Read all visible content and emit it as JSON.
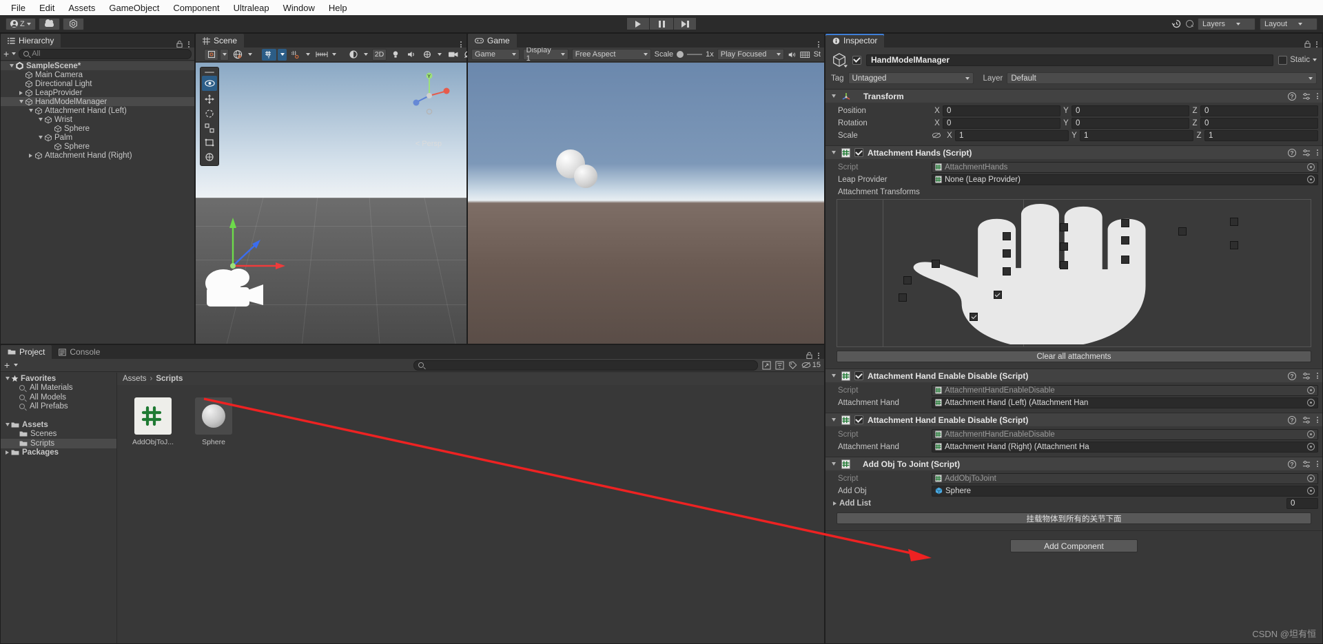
{
  "menubar": {
    "items": [
      "File",
      "Edit",
      "Assets",
      "GameObject",
      "Component",
      "Ultraleap",
      "Window",
      "Help"
    ]
  },
  "toolbar": {
    "account_label": "Z",
    "cloud_icon": "cloud-icon",
    "services_icon": "services-icon",
    "play_icon": "play-icon",
    "pause_icon": "pause-icon",
    "step_icon": "step-icon",
    "history_icon": "history-icon",
    "search_icon": "search-icon",
    "layers_label": "Layers",
    "layout_label": "Layout"
  },
  "hierarchy": {
    "tab": "Hierarchy",
    "search_placeholder": "All",
    "nodes": [
      {
        "label": "SampleScene*",
        "depth": 0,
        "arrow": "down",
        "icon": "unity-icon",
        "selected": false,
        "scene": true
      },
      {
        "label": "Main Camera",
        "depth": 1,
        "arrow": "none",
        "icon": "cube-icon",
        "selected": false
      },
      {
        "label": "Directional Light",
        "depth": 1,
        "arrow": "none",
        "icon": "cube-icon",
        "selected": false
      },
      {
        "label": "LeapProvider",
        "depth": 1,
        "arrow": "right",
        "icon": "cube-icon",
        "selected": false
      },
      {
        "label": "HandModelManager",
        "depth": 1,
        "arrow": "down",
        "icon": "cube-icon",
        "selected": true
      },
      {
        "label": "Attachment Hand (Left)",
        "depth": 2,
        "arrow": "down",
        "icon": "cube-icon",
        "selected": false
      },
      {
        "label": "Wrist",
        "depth": 3,
        "arrow": "down",
        "icon": "cube-icon",
        "selected": false
      },
      {
        "label": "Sphere",
        "depth": 4,
        "arrow": "none",
        "icon": "cube-icon",
        "selected": false
      },
      {
        "label": "Palm",
        "depth": 3,
        "arrow": "down",
        "icon": "cube-icon",
        "selected": false
      },
      {
        "label": "Sphere",
        "depth": 4,
        "arrow": "none",
        "icon": "cube-icon",
        "selected": false
      },
      {
        "label": "Attachment Hand (Right)",
        "depth": 2,
        "arrow": "right",
        "icon": "cube-icon",
        "selected": false
      }
    ]
  },
  "scene": {
    "tab": "Scene",
    "persp_label": "< Persp",
    "toolbar": {
      "draw_mode": "shaded-dropdown",
      "view_2d_label": "2D",
      "gizmo_icons": [
        "pivot-icon",
        "global-icon",
        "grid-snap-icon",
        "grid-visibility-icon",
        "snap-increment-icon",
        "lighting-icon",
        "audio-icon",
        "fx-icon",
        "camera-icon",
        "gizmos-icon"
      ]
    },
    "overlay_tools": [
      "hand-tool",
      "eye-tool",
      "move-tool",
      "rotate-tool",
      "scale-tool",
      "rect-tool",
      "transform-tool",
      "custom-tool"
    ]
  },
  "game": {
    "tab": "Game",
    "view_label": "Game",
    "display_label": "Display 1",
    "aspect_label": "Free Aspect",
    "scale_label": "Scale",
    "scale_value": "1x",
    "play_focused_label": "Play Focused",
    "mute_icon": "mute-audio-icon",
    "stats_label": "St",
    "gizmos_icon": "gizmos-icon"
  },
  "project": {
    "tabs": [
      {
        "label": "Project",
        "icon": "folder-icon",
        "active": true
      },
      {
        "label": "Console",
        "icon": "console-icon",
        "active": false
      }
    ],
    "search_placeholder": "",
    "result_count": "15",
    "breadcrumb": [
      "Assets",
      "Scripts"
    ],
    "sidebar": [
      {
        "label": "Favorites",
        "depth": 0,
        "arrow": "down",
        "icon": "star-icon",
        "bold": true
      },
      {
        "label": "All Materials",
        "depth": 1,
        "arrow": "none",
        "icon": "search-icon"
      },
      {
        "label": "All Models",
        "depth": 1,
        "arrow": "none",
        "icon": "search-icon"
      },
      {
        "label": "All Prefabs",
        "depth": 1,
        "arrow": "none",
        "icon": "search-icon"
      },
      {
        "label": "",
        "depth": 0,
        "arrow": "none",
        "icon": "spacer"
      },
      {
        "label": "Assets",
        "depth": 0,
        "arrow": "down",
        "icon": "folder-icon",
        "bold": true
      },
      {
        "label": "Scenes",
        "depth": 1,
        "arrow": "none",
        "icon": "folder-icon"
      },
      {
        "label": "Scripts",
        "depth": 1,
        "arrow": "none",
        "icon": "folder-icon",
        "selected": true
      },
      {
        "label": "Packages",
        "depth": 0,
        "arrow": "right",
        "icon": "folder-icon",
        "bold": true
      }
    ],
    "assets": [
      {
        "name": "AddObjToJ...",
        "type": "csharp-script"
      },
      {
        "name": "Sphere",
        "type": "prefab-sphere"
      }
    ]
  },
  "inspector": {
    "tab": "Inspector",
    "object_name": "HandModelManager",
    "enabled": true,
    "static_label": "Static",
    "tag_label": "Tag",
    "tag_value": "Untagged",
    "layer_label": "Layer",
    "layer_value": "Default",
    "components": [
      {
        "title": "Transform",
        "icon": "transform-icon",
        "has_checkbox": false,
        "rows": [
          {
            "label": "Position",
            "type": "vector3",
            "x": "0",
            "y": "0",
            "z": "0"
          },
          {
            "label": "Rotation",
            "type": "vector3",
            "x": "0",
            "y": "0",
            "z": "0"
          },
          {
            "label": "Scale",
            "type": "vector3",
            "x": "1",
            "y": "1",
            "z": "1",
            "link_icon": "constrain-off-icon"
          }
        ]
      },
      {
        "title": "Attachment Hands (Script)",
        "icon": "csharp-icon",
        "has_checkbox": true,
        "checked": true,
        "rows": [
          {
            "label": "Script",
            "type": "object",
            "value": "AttachmentHands",
            "dim": true
          },
          {
            "label": "Leap Provider",
            "type": "object",
            "value": "None (Leap Provider)",
            "dim": false
          }
        ],
        "attachment_transforms_label": "Attachment Transforms",
        "clear_button": "Clear all attachments"
      },
      {
        "title": "Attachment Hand Enable Disable (Script)",
        "icon": "csharp-icon",
        "has_checkbox": true,
        "checked": true,
        "rows": [
          {
            "label": "Script",
            "type": "object",
            "value": "AttachmentHandEnableDisable",
            "dim": true
          },
          {
            "label": "Attachment Hand",
            "type": "object",
            "value": "Attachment Hand (Left) (Attachment Han",
            "dim": false
          }
        ]
      },
      {
        "title": "Attachment Hand Enable Disable (Script)",
        "icon": "csharp-icon",
        "has_checkbox": true,
        "checked": true,
        "rows": [
          {
            "label": "Script",
            "type": "object",
            "value": "AttachmentHandEnableDisable",
            "dim": true
          },
          {
            "label": "Attachment Hand",
            "type": "object",
            "value": "Attachment Hand (Right) (Attachment Ha",
            "dim": false
          }
        ]
      },
      {
        "title": "Add Obj To Joint (Script)",
        "icon": "csharp-icon",
        "has_checkbox": false,
        "rows": [
          {
            "label": "Script",
            "type": "object",
            "value": "AddObjToJoint",
            "dim": true
          },
          {
            "label": "Add Obj",
            "type": "object",
            "value": "Sphere",
            "dim": false,
            "prefab": true
          },
          {
            "label": "Add List",
            "type": "foldout",
            "value": "0"
          }
        ],
        "action_button": "挂载物体到所有的关节下面"
      }
    ],
    "add_component_label": "Add Component"
  },
  "watermark": "CSDN @坦有恒",
  "colors": {
    "accent_blue": "#3f7fd8",
    "panel_bg": "#383838",
    "header_bg": "#3b3b3b",
    "arrow_red": "#ee2222"
  }
}
